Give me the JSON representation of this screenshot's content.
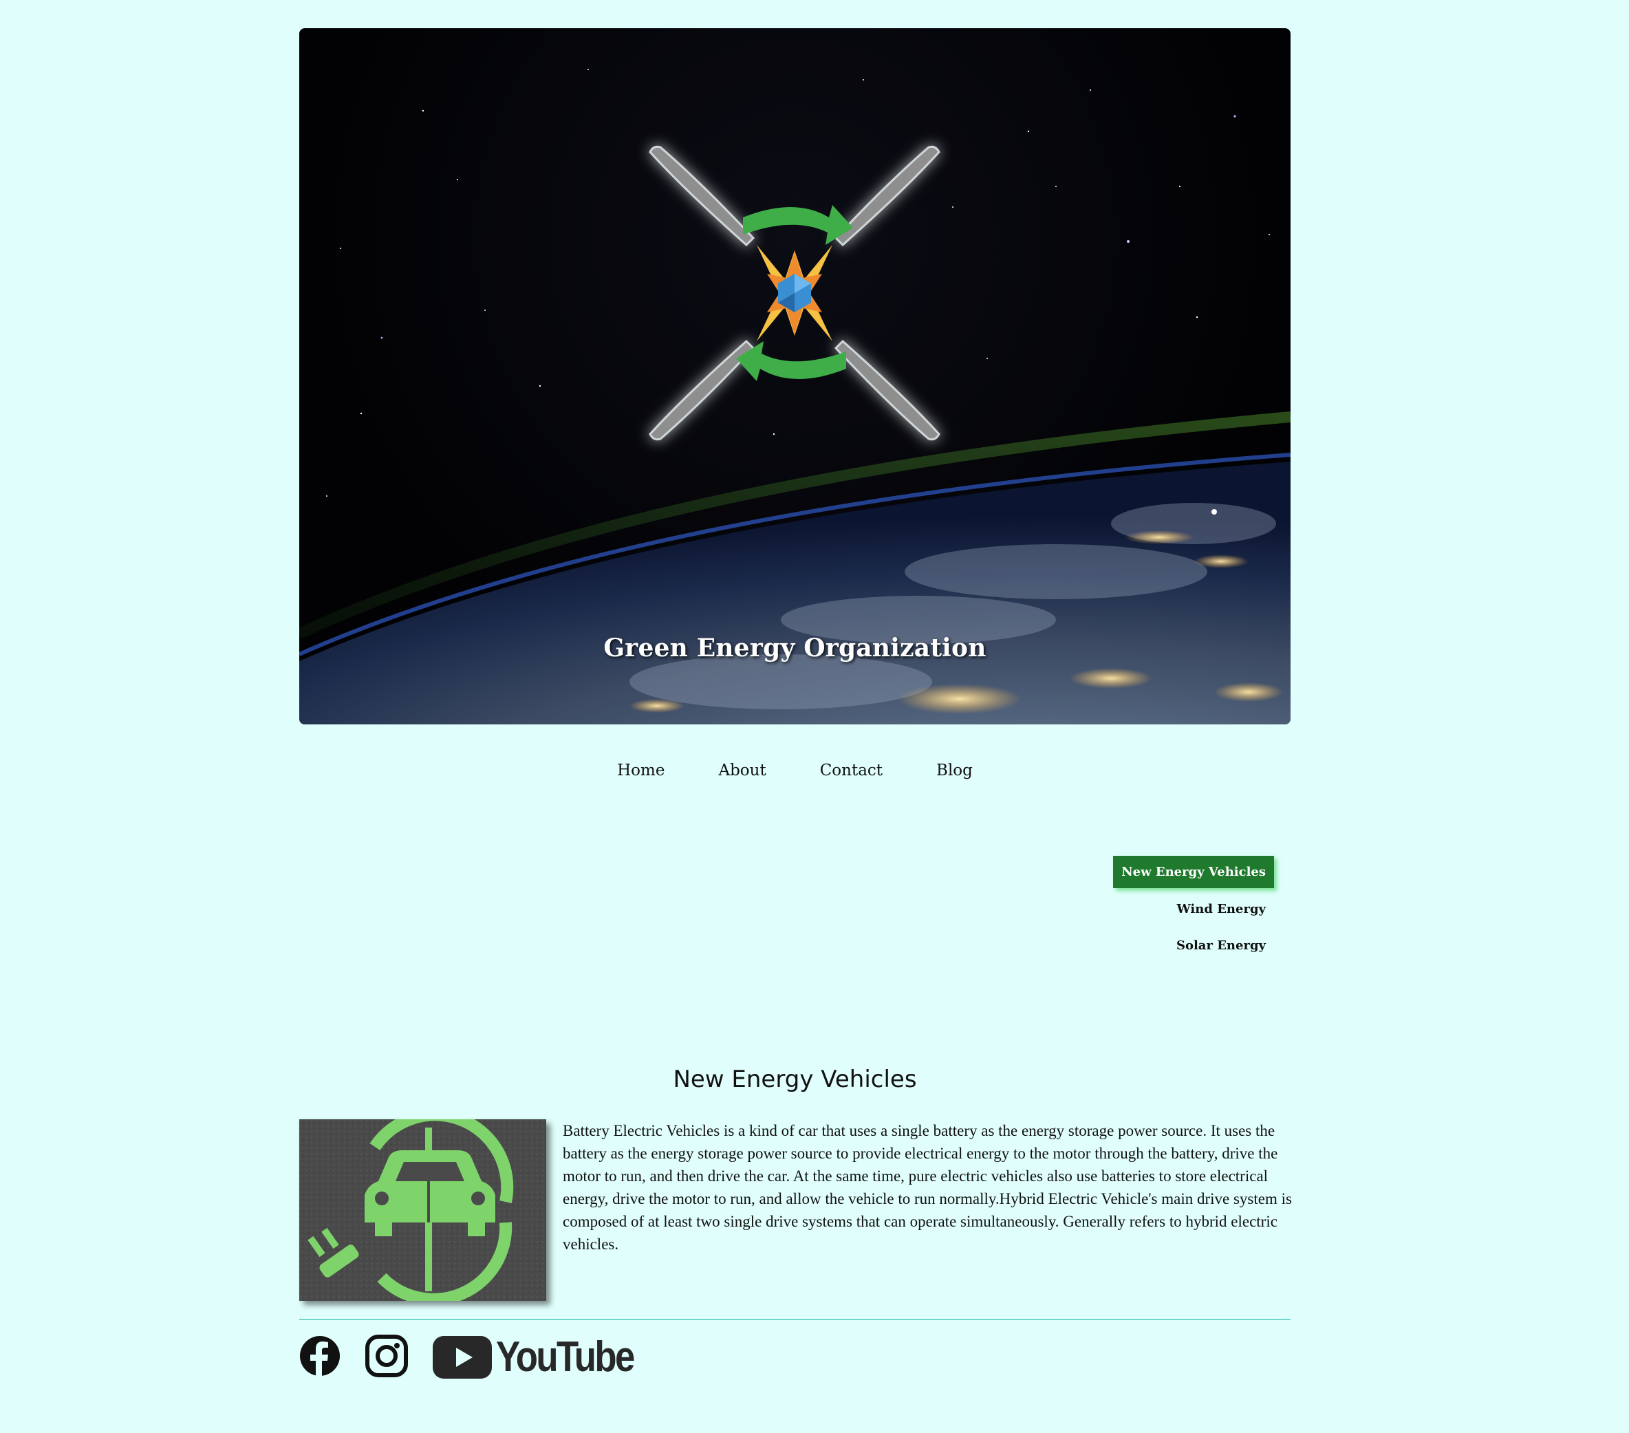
{
  "hero": {
    "title": "Green Energy Organization"
  },
  "nav": {
    "items": [
      {
        "label": "Home"
      },
      {
        "label": "About"
      },
      {
        "label": "Contact"
      },
      {
        "label": "Blog"
      }
    ]
  },
  "sidemenu": {
    "items": [
      {
        "label": "New Energy Vehicles",
        "active": true
      },
      {
        "label": "Wind Energy",
        "active": false
      },
      {
        "label": "Solar Energy",
        "active": false
      }
    ]
  },
  "section": {
    "title": "New Energy Vehicles",
    "body": "Battery Electric Vehicles is a kind of car that uses a single battery as the energy storage power source. It uses the battery as the energy storage power source to provide electrical energy to the motor through the battery, drive the motor to run, and then drive the car. At the same time, pure electric vehicles also use batteries to store electrical energy, drive the motor to run, and allow the vehicle to run normally.Hybrid Electric Vehicle's main drive system is composed of at least two single drive systems that can operate simultaneously. Generally refers to hybrid electric vehicles."
  },
  "social": {
    "youtube_wordmark": "YouTube",
    "icons": [
      "facebook-icon",
      "instagram-icon",
      "youtube-icon"
    ]
  },
  "colors": {
    "page_bg": "#e0fffc",
    "active_menu": "#1f7a2e",
    "divider": "#6fd6cc",
    "logo_green": "#3fae49"
  }
}
